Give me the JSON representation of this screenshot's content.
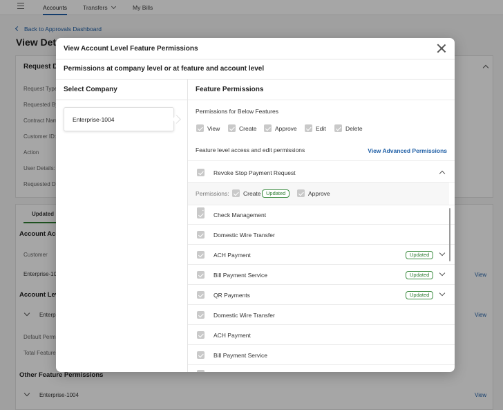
{
  "topnav": {
    "items": [
      "Accounts",
      "Transfers",
      "My Bills"
    ]
  },
  "background": {
    "back_link": "Back to Approvals Dashboard",
    "page_title": "View Deta",
    "request_card_title": "Request De",
    "fields": [
      "Request Type",
      "Requested By",
      "Contract Nam",
      "Customer ID:",
      "Action",
      "User Details:",
      "Requested D"
    ],
    "tab_label": "Updated",
    "account_access_heading": "Account Acc",
    "customer_label": "Customer",
    "enterprise_short": "Enterprise-10",
    "account_level_heading": "Account Lev",
    "enterprise_short2": "Enterp",
    "default_perm": "Default Perm",
    "total_feature": "Total Feature",
    "other_heading": "Other Feature Permissions",
    "other_enterprise": "Enterprise-1004",
    "view_label": "View"
  },
  "modal": {
    "title": "View Account Level Feature Permissions",
    "subtitle": "Permissions at company level or at feature and account level",
    "select_company_heading": "Select Company",
    "company": "Enterprise-1004",
    "feature_permissions_heading": "Feature Permissions",
    "permissions_for_below": "Permissions for Below Features",
    "global_permissions": [
      "View",
      "Create",
      "Approve",
      "Edit",
      "Delete"
    ],
    "feature_level_text": "Feature level access and edit permissions",
    "advanced_link": "View Advanced Permissions",
    "expanded_feature": {
      "name": "Revoke Stop Payment Request",
      "permissions_label": "Permissions:",
      "create_label": "Create",
      "updated_badge": "Updated",
      "approve_label": "Approve"
    },
    "features": [
      {
        "name": "Check Management",
        "badge": ""
      },
      {
        "name": "Domestic Wire Transfer",
        "badge": ""
      },
      {
        "name": "ACH Payment",
        "badge": "Updated"
      },
      {
        "name": "Bill Payment Service",
        "badge": "Updated"
      },
      {
        "name": "QR Payments",
        "badge": "Updated"
      },
      {
        "name": "Domestic Wire Transfer",
        "badge": ""
      },
      {
        "name": "ACH Payment",
        "badge": ""
      },
      {
        "name": "Bill Payment Service",
        "badge": ""
      }
    ]
  }
}
